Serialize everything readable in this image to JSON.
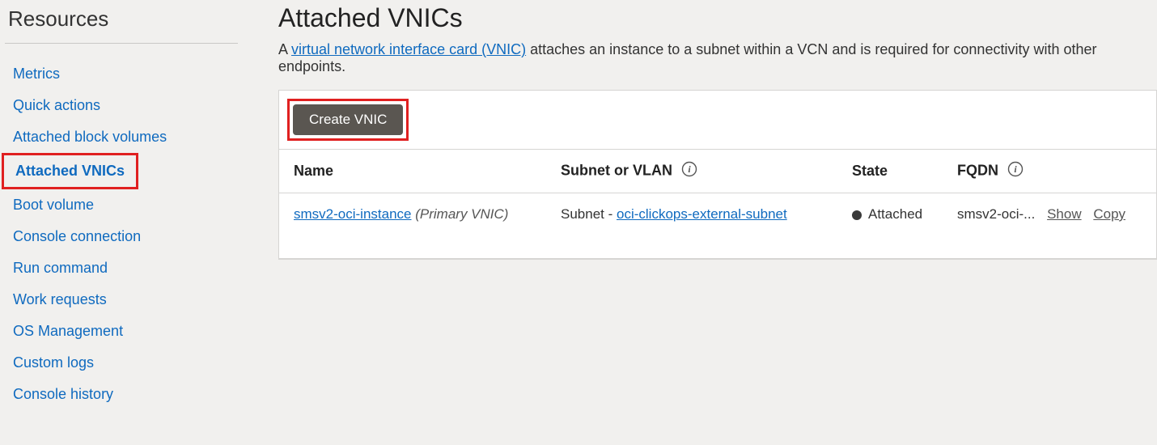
{
  "sidebar": {
    "title": "Resources",
    "items": [
      {
        "label": "Metrics",
        "active": false
      },
      {
        "label": "Quick actions",
        "active": false
      },
      {
        "label": "Attached block volumes",
        "active": false
      },
      {
        "label": "Attached VNICs",
        "active": true
      },
      {
        "label": "Boot volume",
        "active": false
      },
      {
        "label": "Console connection",
        "active": false
      },
      {
        "label": "Run command",
        "active": false
      },
      {
        "label": "Work requests",
        "active": false
      },
      {
        "label": "OS Management",
        "active": false
      },
      {
        "label": "Custom logs",
        "active": false
      },
      {
        "label": "Console history",
        "active": false
      }
    ]
  },
  "main": {
    "title": "Attached VNICs",
    "desc_prefix": "A ",
    "desc_link": "virtual network interface card (VNIC)",
    "desc_suffix": " attaches an instance to a subnet within a VCN and is required for connectivity with other endpoints.",
    "create_button": "Create VNIC",
    "columns": {
      "name": "Name",
      "subnet": "Subnet or VLAN",
      "state": "State",
      "fqdn": "FQDN"
    },
    "rows": [
      {
        "name_link": "smsv2-oci-instance",
        "name_suffix": "(Primary VNIC)",
        "subnet_prefix": "Subnet - ",
        "subnet_link": "oci-clickops-external-subnet",
        "state": "Attached",
        "fqdn_truncated": "smsv2-oci-...",
        "fqdn_show": "Show",
        "fqdn_copy": "Copy"
      }
    ]
  }
}
